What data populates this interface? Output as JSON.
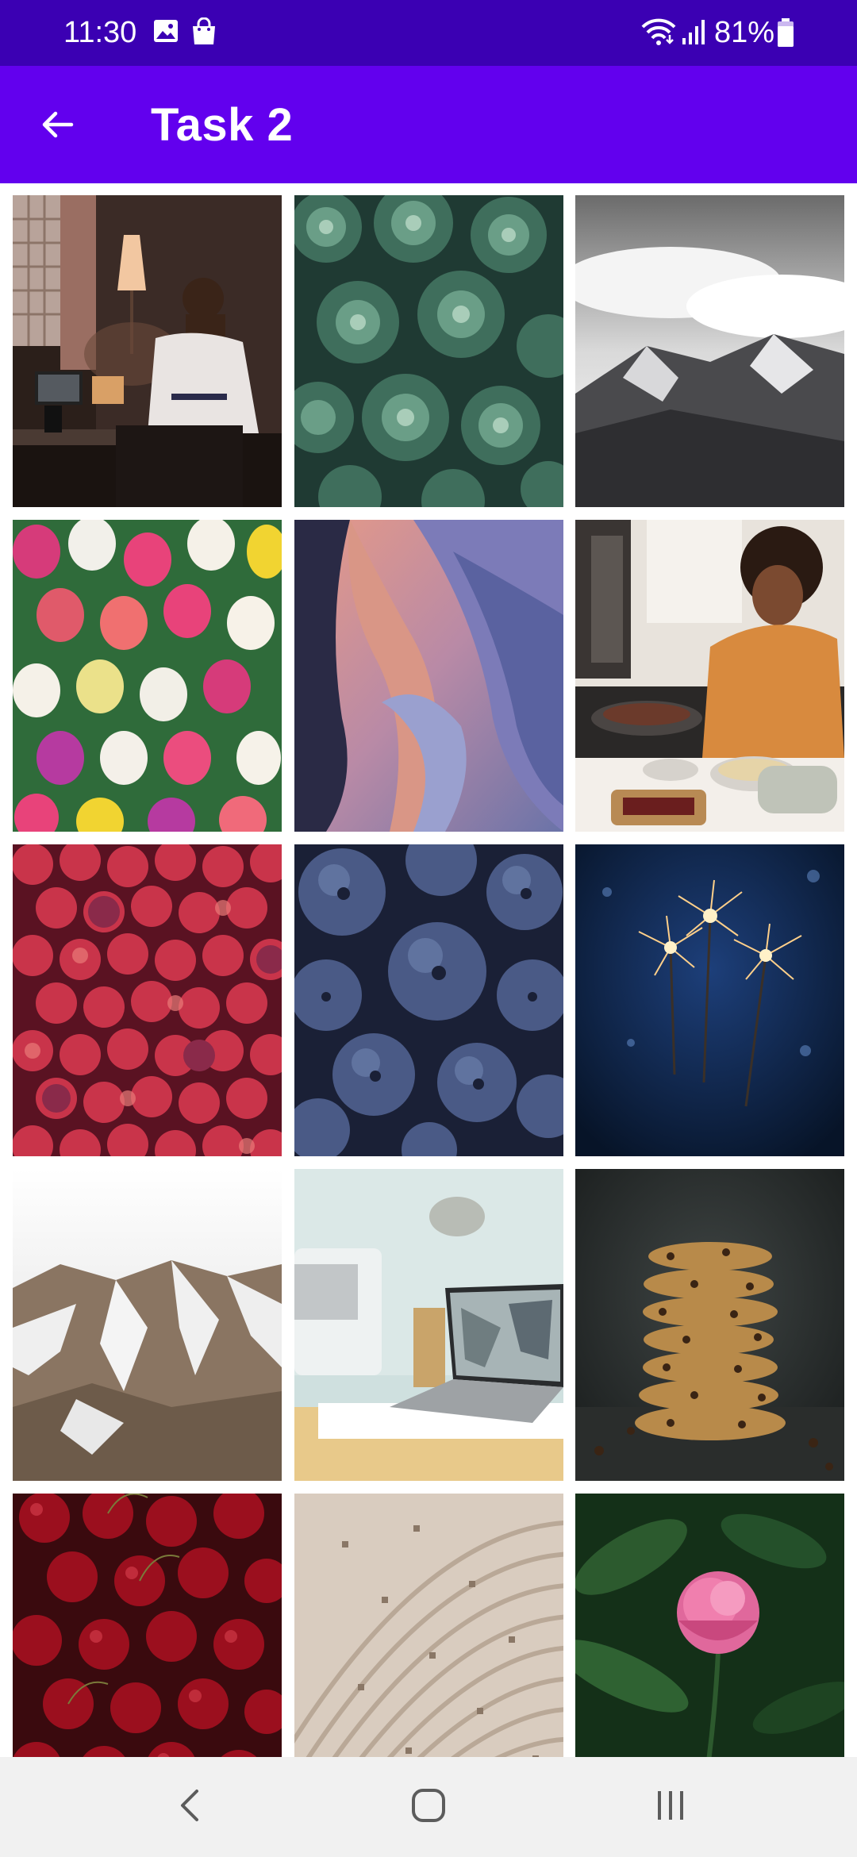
{
  "status_bar": {
    "time": "11:30",
    "battery": "81%",
    "icons": [
      "gallery-icon",
      "shopping-bag-icon",
      "wifi-icon",
      "signal-icon",
      "battery-icon"
    ]
  },
  "app_bar": {
    "title": "Task 2",
    "back_icon": "arrow-left-icon",
    "background": "#6200ee"
  },
  "colors": {
    "status_bar": "#3b00b3",
    "app_bar": "#6200ee",
    "nav_bar": "#f1f1f1"
  },
  "gallery": {
    "columns": 3,
    "photos": [
      {
        "id": "man-at-desk"
      },
      {
        "id": "succulents"
      },
      {
        "id": "snowy-mountains"
      },
      {
        "id": "tulips"
      },
      {
        "id": "sandstone-canyon"
      },
      {
        "id": "woman-cooking"
      },
      {
        "id": "apples"
      },
      {
        "id": "blueberries"
      },
      {
        "id": "sparklers"
      },
      {
        "id": "brown-hills"
      },
      {
        "id": "laptop-interior"
      },
      {
        "id": "cookie-stack"
      },
      {
        "id": "cherries"
      },
      {
        "id": "wooden-pattern"
      },
      {
        "id": "pink-peony"
      }
    ]
  },
  "nav_bar": {
    "buttons": [
      "back-nav-icon",
      "home-icon",
      "recents-icon"
    ]
  }
}
